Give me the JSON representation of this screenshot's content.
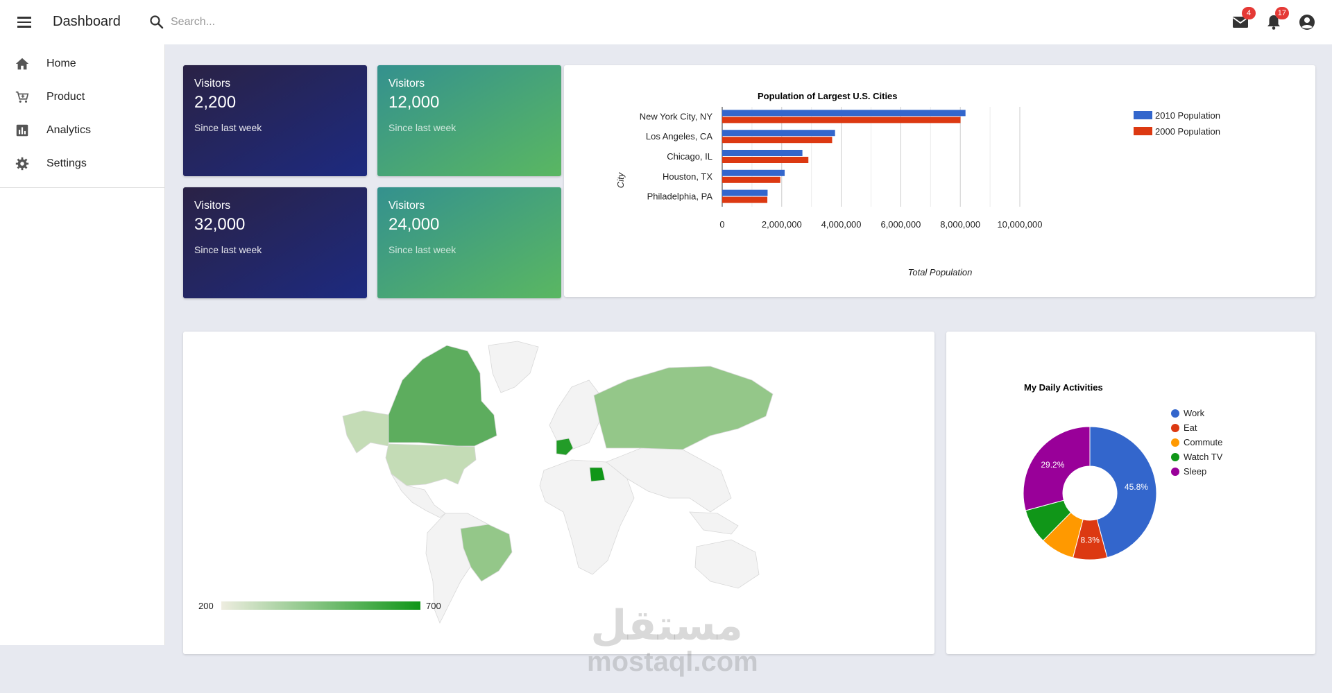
{
  "appbar": {
    "title": "Dashboard",
    "search_placeholder": "Search...",
    "mail_badge": "4",
    "notifications_badge": "17"
  },
  "sidebar": {
    "items": [
      {
        "label": "Home",
        "icon": "home-icon"
      },
      {
        "label": "Product",
        "icon": "cart-icon"
      },
      {
        "label": "Analytics",
        "icon": "chart-icon"
      },
      {
        "label": "Settings",
        "icon": "gear-icon"
      }
    ]
  },
  "stats": [
    {
      "label": "Visitors",
      "value": "2,200",
      "sub": "Since last week"
    },
    {
      "label": "Visitors",
      "value": "12,000",
      "sub": "Since last week"
    },
    {
      "label": "Visitors",
      "value": "32,000",
      "sub": "Since last week"
    },
    {
      "label": "Visitors",
      "value": "24,000",
      "sub": "Since last week"
    }
  ],
  "chart_data": [
    {
      "type": "bar",
      "orientation": "horizontal",
      "title": "Population of Largest U.S. Cities",
      "xlabel": "Total Population",
      "ylabel": "City",
      "categories": [
        "New York City, NY",
        "Los Angeles, CA",
        "Chicago, IL",
        "Houston, TX",
        "Philadelphia, PA"
      ],
      "series": [
        {
          "name": "2010 Population",
          "color": "#3366cc",
          "values": [
            8175000,
            3792000,
            2695000,
            2099000,
            1526000
          ]
        },
        {
          "name": "2000 Population",
          "color": "#dc3912",
          "values": [
            8008000,
            3694000,
            2896000,
            1953000,
            1517000
          ]
        }
      ],
      "xlim": [
        0,
        10000000
      ],
      "xticks": [
        "0",
        "2,000,000",
        "4,000,000",
        "6,000,000",
        "8,000,000",
        "10,000,000"
      ],
      "grid": true,
      "legend": "right"
    },
    {
      "type": "pie",
      "donut": true,
      "title": "My Daily Activities",
      "slices": [
        {
          "name": "Work",
          "value": 45.8,
          "label": "45.8%",
          "color": "#3366cc"
        },
        {
          "name": "Eat",
          "value": 8.3,
          "label": "8.3%",
          "color": "#dc3912"
        },
        {
          "name": "Commute",
          "value": 8.3,
          "label": "",
          "color": "#ff9900"
        },
        {
          "name": "Watch TV",
          "value": 8.4,
          "label": "",
          "color": "#109618"
        },
        {
          "name": "Sleep",
          "value": 29.2,
          "label": "29.2%",
          "color": "#990099"
        }
      ],
      "legend": "right"
    }
  ],
  "map": {
    "scale_min": "200",
    "scale_max": "700"
  },
  "watermark": {
    "arabic": "مستقل",
    "latin": "mostaql.com"
  }
}
